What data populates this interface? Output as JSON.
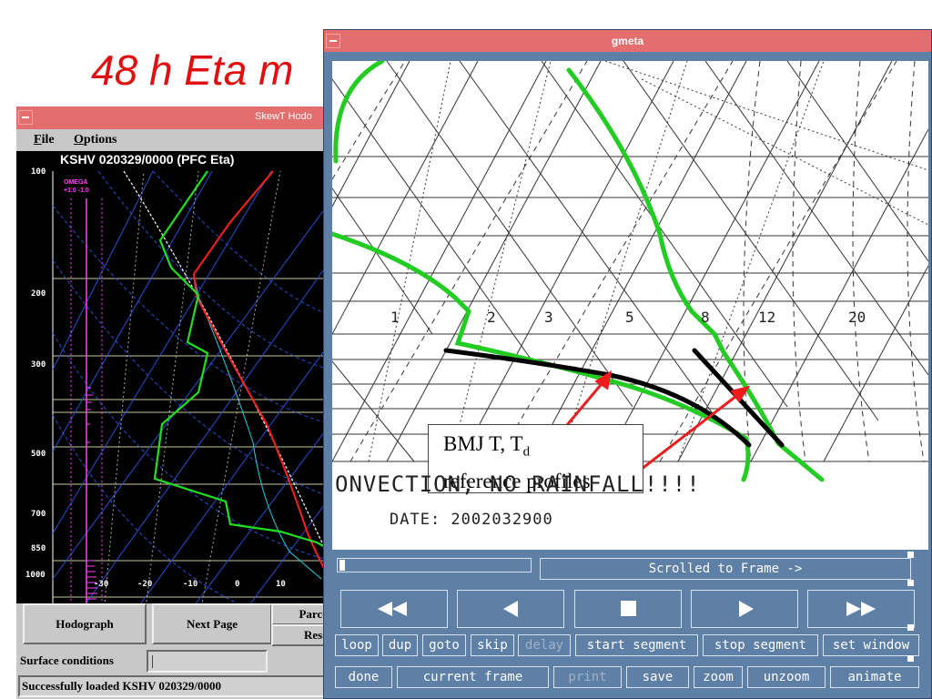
{
  "slide": {
    "title": "48 h Eta m"
  },
  "skewt_window": {
    "title": "SkewT Hodo",
    "menu": {
      "file": "File",
      "file_rest": "ile",
      "file_mnemonic": "F",
      "options": "Options",
      "options_mnemonic": "O",
      "options_rest": "ptions"
    },
    "header": "KSHV  020329/0000  (PFC Eta)",
    "omega_label": "OMEGA",
    "omega_scale": "+1.0  -1.0",
    "pressure_labels": [
      "100",
      "200",
      "300",
      "500",
      "700",
      "850",
      "1000"
    ],
    "temperature_labels": [
      "-30",
      "-20",
      "-10",
      "0",
      "10"
    ],
    "buttons": {
      "hodograph": "Hodograph",
      "next_page": "Next Page",
      "parcel": "Parce",
      "reset": "Rese"
    },
    "surface_label": "Surface conditions",
    "surface_value": "",
    "status": "Successfully loaded  KSHV  020329/0000",
    "colors": {
      "temperature": "#ff2020",
      "dewpoint": "#20e020",
      "omega": "#ff40ff",
      "titlebar": "#e46d6d"
    }
  },
  "gmeta_window": {
    "title": "gmeta",
    "mixing_ratio_labels": [
      "1",
      "2",
      "3",
      "5",
      "8",
      "12",
      "20"
    ],
    "plot_text": "ONVECTION; NO RAINFALL!!!!",
    "date_text": "DATE:   2002032900",
    "annotation": {
      "line1": "BMJ T, T",
      "subscript": "d",
      "line2": "reference profiles"
    },
    "frame_status": "Scrolled to Frame ->",
    "playback": [
      {
        "name": "rewind-icon",
        "glyph": "◀◀"
      },
      {
        "name": "step-back-icon",
        "glyph": "◀"
      },
      {
        "name": "stop-icon",
        "glyph": "■"
      },
      {
        "name": "play-icon",
        "glyph": "▶"
      },
      {
        "name": "fast-forward-icon",
        "glyph": "▶▶"
      }
    ],
    "row1_buttons": [
      "loop",
      "dup",
      "goto",
      "skip",
      "delay",
      "start segment",
      "stop segment",
      "set window"
    ],
    "row2_buttons": [
      "done",
      "current frame",
      "print",
      "save",
      "zoom",
      "unzoom",
      "animate"
    ],
    "colors": {
      "background": "#5e7fa6",
      "profile": "#22cc22",
      "reference": "#000000",
      "arrow": "#ee1c1c"
    }
  }
}
